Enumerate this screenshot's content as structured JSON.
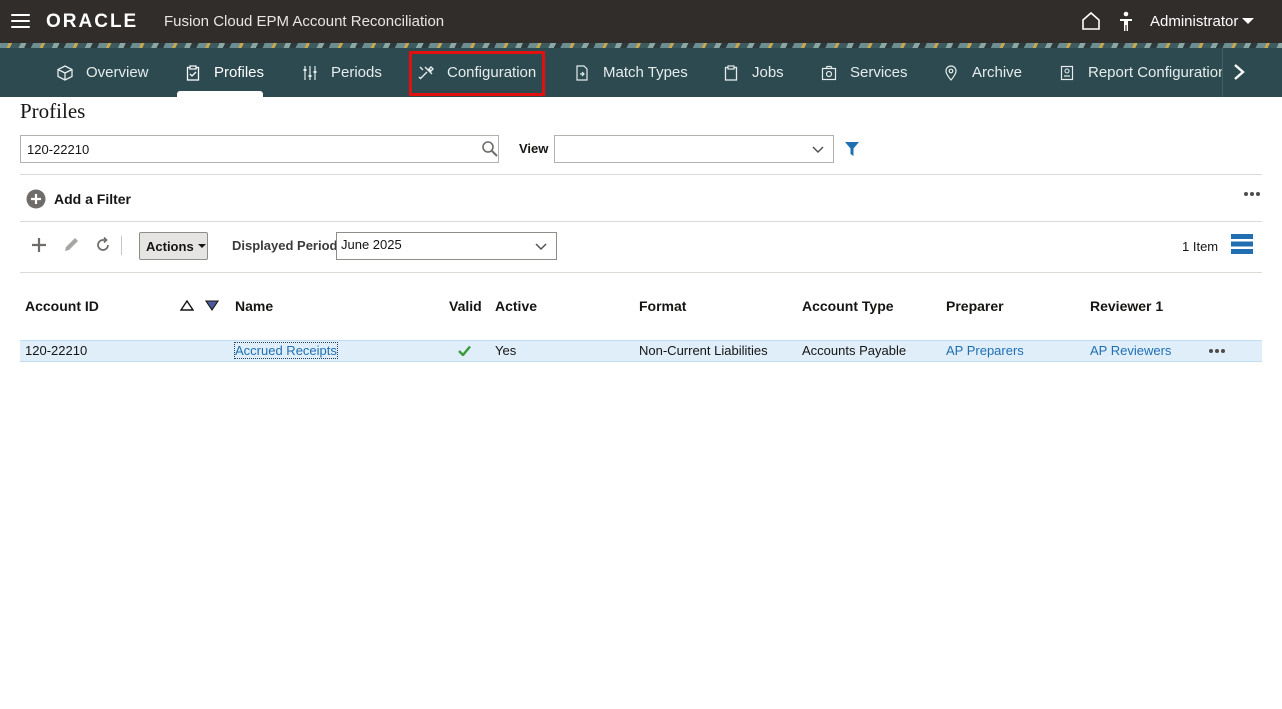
{
  "header": {
    "logo_text": "ORACLE",
    "app_title": "Fusion Cloud EPM Account Reconciliation",
    "user": "Administrator"
  },
  "nav": {
    "tabs": [
      {
        "label": "Overview",
        "icon": "cube-icon"
      },
      {
        "label": "Profiles",
        "icon": "clipboard-check-icon",
        "active": true
      },
      {
        "label": "Periods",
        "icon": "sliders-icon"
      },
      {
        "label": "Configuration",
        "icon": "tools-icon",
        "highlighted": true
      },
      {
        "label": "Match Types",
        "icon": "document-match-icon"
      },
      {
        "label": "Jobs",
        "icon": "clipboard-icon"
      },
      {
        "label": "Services",
        "icon": "camera-box-icon"
      },
      {
        "label": "Archive",
        "icon": "location-pin-icon"
      },
      {
        "label": "Report Configuration",
        "icon": "report-icon"
      }
    ],
    "highlight_color": "#e0110e"
  },
  "page": {
    "title": "Profiles",
    "search_value": "120-22210",
    "view_label": "View",
    "view_value": "",
    "add_filter_label": "Add a Filter",
    "actions_label": "Actions",
    "displayed_period_label": "Displayed Period",
    "displayed_period_value": "June 2025",
    "item_count": "1 Item"
  },
  "table": {
    "columns": [
      "Account ID",
      "Name",
      "Valid",
      "Active",
      "Format",
      "Account Type",
      "Preparer",
      "Reviewer 1"
    ],
    "rows": [
      {
        "account_id": "120-22210",
        "name": "Accrued Receipts",
        "valid": true,
        "active": "Yes",
        "format": "Non-Current Liabilities",
        "account_type": "Accounts Payable",
        "preparer": "AP Preparers",
        "reviewer1": "AP Reviewers"
      }
    ]
  },
  "colors": {
    "header_bg": "#312d2a",
    "nav_bg": "#2c4a50",
    "link": "#1f6fb2",
    "row_selected": "#dfeef9",
    "filter_icon": "#1f6fb2"
  }
}
